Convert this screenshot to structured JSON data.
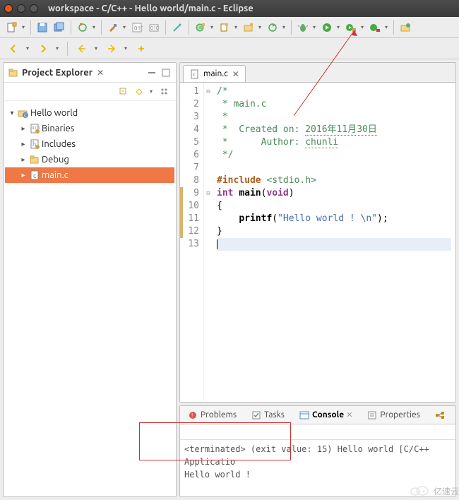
{
  "window": {
    "title": "workspace - C/C++ - Hello world/main.c - Eclipse"
  },
  "explorer": {
    "title": "Project Explorer",
    "items": [
      {
        "label": "Hello world",
        "depth": 0,
        "expanded": true,
        "icon": "folder-c",
        "selected": false
      },
      {
        "label": "Binaries",
        "depth": 1,
        "expanded": false,
        "icon": "binaries",
        "selected": false
      },
      {
        "label": "Includes",
        "depth": 1,
        "expanded": false,
        "icon": "includes",
        "selected": false
      },
      {
        "label": "Debug",
        "depth": 1,
        "expanded": false,
        "icon": "folder",
        "selected": false
      },
      {
        "label": "main.c",
        "depth": 1,
        "expanded": false,
        "icon": "c-file",
        "selected": true
      }
    ]
  },
  "editor": {
    "tab": {
      "label": "main.c"
    },
    "lines": [
      {
        "n": 1,
        "html": "<span class='c-comment'>/*</span>"
      },
      {
        "n": 2,
        "html": "<span class='c-comment'> * main.c</span>"
      },
      {
        "n": 3,
        "html": "<span class='c-comment'> *</span>"
      },
      {
        "n": 4,
        "html": "<span class='c-comment'> *  Created on: <span class='c-squig'>2016年11月30日</span></span>"
      },
      {
        "n": 5,
        "html": "<span class='c-comment'> *      Author: <span class='c-squig'>chunli</span></span>"
      },
      {
        "n": 6,
        "html": "<span class='c-comment'> */</span>"
      },
      {
        "n": 7,
        "html": ""
      },
      {
        "n": 8,
        "html": "<span class='c-pp'>#include</span> <span class='c-inc'>&lt;stdio.h&gt;</span>"
      },
      {
        "n": 9,
        "html": "<span class='c-kw'>int</span> <span class='c-fn'>main</span>(<span class='c-kw'>void</span>)",
        "mark": true,
        "fold": true
      },
      {
        "n": 10,
        "html": "{",
        "mark": true
      },
      {
        "n": 11,
        "html": "    <span class='c-fn'>printf</span>(<span class='c-str'>\"Hello world ! \\n\"</span>);",
        "mark": true
      },
      {
        "n": 12,
        "html": "}",
        "mark": true
      },
      {
        "n": 13,
        "html": "",
        "last": true
      }
    ]
  },
  "bottom": {
    "tabs": [
      {
        "label": "Problems",
        "icon": "problems",
        "active": false
      },
      {
        "label": "Tasks",
        "icon": "tasks",
        "active": false
      },
      {
        "label": "Console",
        "icon": "console",
        "active": true
      },
      {
        "label": "Properties",
        "icon": "properties",
        "active": false
      }
    ],
    "status": "<terminated> (exit value: 15) Hello world [C/C++ Applicatio",
    "output": "Hello world !"
  },
  "watermark": "亿速云"
}
